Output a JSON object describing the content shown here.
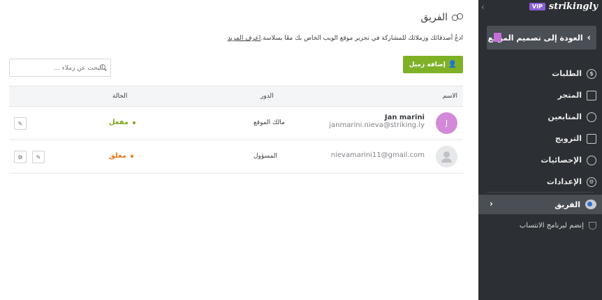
{
  "brand": {
    "vip": "VIP",
    "name": "strikingly"
  },
  "sidebar": {
    "back_label": "العودة إلى تصميم الموقع",
    "items": [
      {
        "label": "الطلبات",
        "icon": "dollar-icon"
      },
      {
        "label": "المتجر",
        "icon": "store-icon"
      },
      {
        "label": "المتابعين",
        "icon": "followers-icon"
      },
      {
        "label": "الترويج",
        "icon": "megaphone-icon"
      },
      {
        "label": "الإحصائيات",
        "icon": "pie-chart-icon"
      },
      {
        "label": "الإعدادات",
        "icon": "gear-icon"
      }
    ],
    "active_label": "الفريق",
    "referral_label": "إنضم لبرنامج الانتساب"
  },
  "main": {
    "title": "الفريق",
    "subtitle": "ادعُ أصدقائك وزملائك للمشاركة في تحرير موقع الويب الخاص بك معًا بسلاسة.",
    "learn_more": "اعرف المزيد",
    "add_button": "إضافة زميل",
    "search_placeholder": "البحث عن زملاء ..."
  },
  "table": {
    "headers": {
      "name": "الاسم",
      "role": "الدور",
      "status": "الحالة"
    },
    "rows": [
      {
        "avatar_letter": "J",
        "name": "Jan marini",
        "email": "janmarini.nieva@striking.ly",
        "role": "مالك الموقع",
        "status": "مفعل"
      },
      {
        "avatar_letter": "",
        "name": "",
        "email": "nievamarini11@gmail.com",
        "role": "المسؤول",
        "status": "معلق"
      }
    ]
  },
  "colors": {
    "sidebar_bg": "#2c2f33",
    "accent_green": "#7fb127",
    "status_active": "#7fa317",
    "status_pending": "#e8771a",
    "vip_purple": "#8b5fd6"
  }
}
